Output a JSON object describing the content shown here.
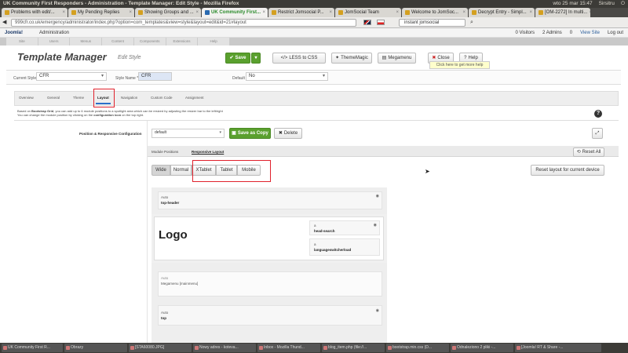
{
  "os": {
    "title": "UK Community First Responders - Administration - Template Manager: Edit Style - Mozilla Firefox",
    "clock": "wto 25 mar 15:47",
    "user": "Sirsitru"
  },
  "tabs": [
    "Problems with edit/...",
    "My Pending Replies",
    "Showing Groups and ...",
    "UK Community First...",
    "Restrict Jomsocial P...",
    "JomSocial Team",
    "Welcome to JomSoc...",
    "Decrypt Entry - Simpl...",
    "[OM-2272] In multi..."
  ],
  "urlbar": {
    "url": "999cfr.co.uk/emergency/administrator/index.php?option=com_templates&view=style&layout=edit&id=21#layout",
    "search": "instant jomsocial"
  },
  "joomla": {
    "logo": "Joomla!",
    "admin": "Administration",
    "visitors": "0 Visitors",
    "admins": "2 Admins",
    "count": "0",
    "view_site": "View Site",
    "logout": "Log out"
  },
  "nav": [
    "Site",
    "Users",
    "Menus",
    "Content",
    "Components",
    "Extensions",
    "Help"
  ],
  "toolbar": {
    "title": "Template Manager",
    "subtitle": "Edit Style",
    "save": "Save",
    "less": "LESS to CSS",
    "thememagic": "ThemeMagic",
    "megamenu": "Megamenu",
    "close": "Close",
    "help": "Help",
    "tip": "Click here to get more help"
  },
  "stylebar": {
    "current_label": "Current Style",
    "current_value": "CFR",
    "name_label": "Style Name *",
    "name_value": "CFR",
    "default_label": "Default",
    "default_value": "No"
  },
  "subtabs": [
    "Overview",
    "General",
    "Theme",
    "Layout",
    "Navigation",
    "Custom Code",
    "Assignment"
  ],
  "info": {
    "line1_pre": "Based on ",
    "line1_bold": "Bootstrap Grid",
    "line1_post": ", you can add up to 6 module positions to a spotlight area which can be resized by adjusting the resizer bar to the left/right",
    "line2_pre": "You can change the module position by clicking on the ",
    "line2_bold": "configuration icon",
    "line2_post": " on the top right."
  },
  "layout": {
    "config_label": "Position & Responsive Configuration",
    "select": "default",
    "save_copy": "Save as Copy",
    "delete": "Delete",
    "mod_positions": "Module Positions",
    "responsive": "Responsive Layout",
    "reset_all": "Reset All",
    "modes": [
      "Wide",
      "Normal",
      "XTablet",
      "Tablet",
      "Mobile"
    ],
    "reset_current": "Reset layout for current device"
  },
  "blocks": {
    "b1_auto": "Auto",
    "b1_name": "top-header",
    "logo": "Logo",
    "b2_a": "a",
    "b2_a_name": "head-search",
    "b2_b": "a",
    "b2_b_name": "languageswitcherload",
    "b3_auto": "Auto",
    "b3_name": "Megamenu [mainmenu]",
    "b4_auto": "Auto",
    "b4_name": "top"
  },
  "taskbar": [
    "UK Community First R...",
    "Obrazy",
    "[STA60080.JPG]",
    "Nowy adres - koteva...",
    "Inbox - Mozilla Thund...",
    "blog_item.php (file://...",
    "bootstrap.min.css (D...",
    "Odnaleziono 2 pliki -...",
    "[Joomla! RT & Share -..."
  ]
}
